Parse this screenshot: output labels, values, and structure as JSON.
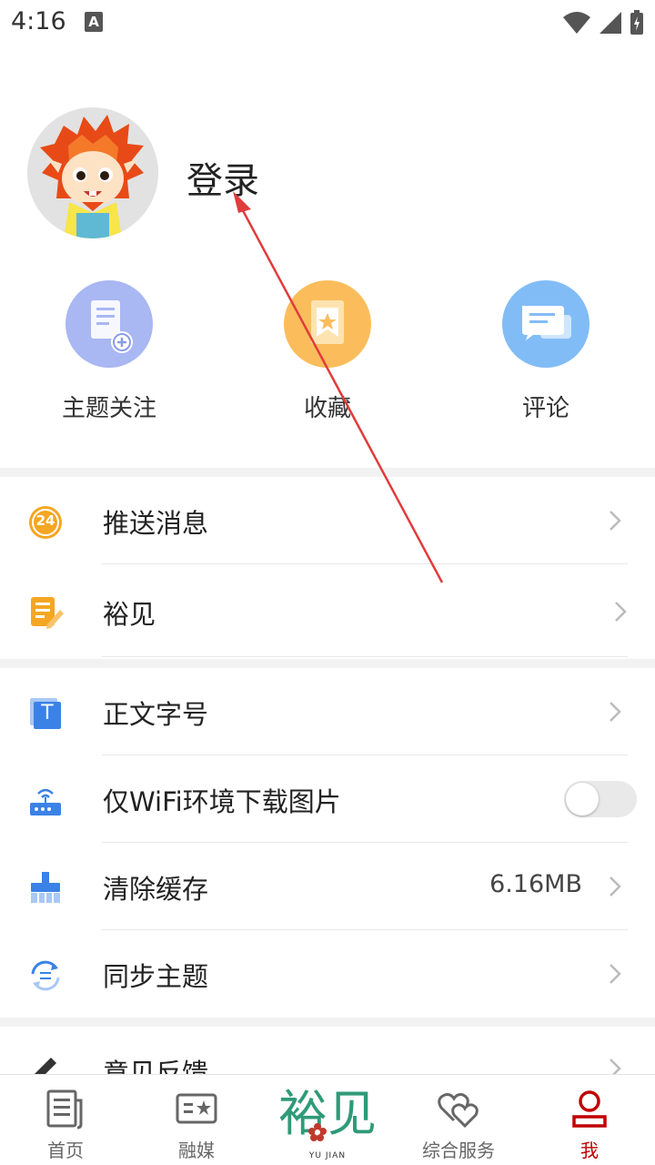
{
  "status_bar": {
    "time": "4:16",
    "notification_icon": "A"
  },
  "profile": {
    "login_label": "登录",
    "avatar": "lion-mascot-avatar"
  },
  "quick_actions": [
    {
      "label": "主题关注",
      "icon": "subscribe-doc-icon",
      "color": "#a9b7f2"
    },
    {
      "label": "收藏",
      "icon": "bookmark-star-icon",
      "color": "#fbbd5c"
    },
    {
      "label": "评论",
      "icon": "comment-bubbles-icon",
      "color": "#82bcf6"
    }
  ],
  "menu": {
    "push": {
      "label": "推送消息",
      "icon": "push-24-icon",
      "badge": "24"
    },
    "yujian": {
      "label": "裕见",
      "icon": "notes-pen-icon"
    },
    "font_size": {
      "label": "正文字号",
      "icon": "font-size-icon",
      "glyph": "T"
    },
    "wifi_images": {
      "label": "仅WiFi环境下载图片",
      "icon": "router-icon",
      "enabled": false
    },
    "clear_cache": {
      "label": "清除缓存",
      "icon": "broom-icon",
      "value": "6.16MB"
    },
    "sync_topics": {
      "label": "同步主题",
      "icon": "sync-icon"
    },
    "feedback": {
      "label": "意见反馈",
      "icon": "pencil-icon"
    }
  },
  "bottom_nav": {
    "home": "首页",
    "media": "融媒",
    "logo_text": "裕见",
    "logo_sub": "YU JIAN",
    "services": "综合服务",
    "me": "我"
  },
  "colors": {
    "accent": "#c00000",
    "orange": "#f5a623",
    "blue": "#3b82e6",
    "annotation": "#e03c3c"
  }
}
